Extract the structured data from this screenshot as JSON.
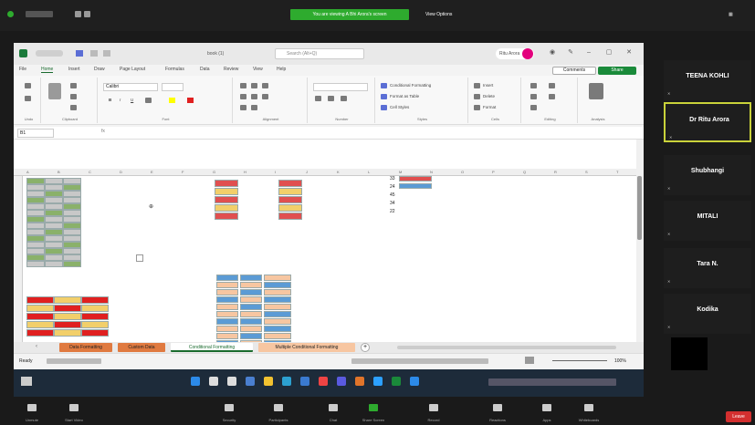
{
  "zoom": {
    "banner": "You are viewing A Bhi Arora's screen",
    "view_options": "View Options",
    "participants": [
      {
        "name": "TEENA KOHLI"
      },
      {
        "name": "Dr Ritu Arora"
      },
      {
        "name": "Shubhangi"
      },
      {
        "name": "MITALI"
      },
      {
        "name": "Tara N."
      },
      {
        "name": "Kodika"
      }
    ],
    "toolbar": [
      "Unmute",
      "Start Video",
      "Security",
      "Participants",
      "Chat",
      "Share Screen",
      "Record",
      "Reactions",
      "Apps",
      "Whiteboards"
    ],
    "leave": "Leave"
  },
  "excel": {
    "doc_name": "book (1)",
    "search_placeholder": "Search (Alt+Q)",
    "user": "Ritu Arora",
    "menu": [
      "File",
      "Home",
      "Insert",
      "Draw",
      "Page Layout",
      "Formulas",
      "Data",
      "Review",
      "View",
      "Help"
    ],
    "comments": "Comments",
    "share": "Share",
    "font": "Calibri",
    "ribbon_groups": [
      "Undo",
      "Clipboard",
      "Font",
      "Alignment",
      "Number",
      "Styles",
      "Cells",
      "Editing",
      "Analysis"
    ],
    "styles": [
      "Conditional Formatting",
      "Format as Table",
      "Cell Styles"
    ],
    "cells": [
      "Insert",
      "Delete",
      "Format"
    ],
    "name_box": "B1",
    "fx": "fx",
    "sheets": [
      "Data Formatting",
      "Custom Data",
      "Conditional Formatting",
      "Multiple Conditional Formatting"
    ],
    "status_left": "Ready",
    "status_zoom": "100%",
    "values_right": [
      "33",
      "24",
      "45",
      "34",
      "22"
    ]
  },
  "colors": {
    "green": "#8ab16a",
    "grey": "#c8c8c8",
    "red": "#e02020",
    "yellow": "#f2cf6a",
    "peach": "#f7c6a1",
    "blue": "#5b9bd5",
    "darkred": "#e05050"
  }
}
